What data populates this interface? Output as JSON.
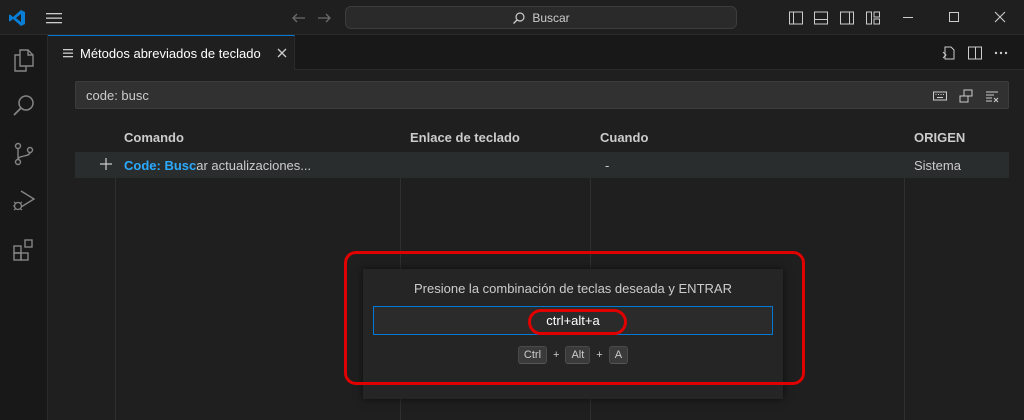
{
  "titlebar": {
    "search_label": "Buscar"
  },
  "tab": {
    "title": "Métodos abreviados de teclado"
  },
  "keybindings": {
    "search_value": "code: busc",
    "columns": [
      "Comando",
      "Enlace de teclado",
      "Cuando",
      "ORIGEN"
    ],
    "rows": [
      {
        "command_highlight": "Code: Busc",
        "command_rest": "ar actualizaciones...",
        "keybinding": "",
        "when": "-",
        "source": "Sistema"
      }
    ]
  },
  "dialog": {
    "message": "Presione la combinación de teclas deseada y ENTRAR",
    "input_value": "ctrl+alt+a",
    "keys": [
      "Ctrl",
      "Alt",
      "A"
    ],
    "separator": "+"
  },
  "colors": {
    "accent": "#0078d4",
    "highlight": "#2aaaff",
    "annotation": "#e00000"
  }
}
